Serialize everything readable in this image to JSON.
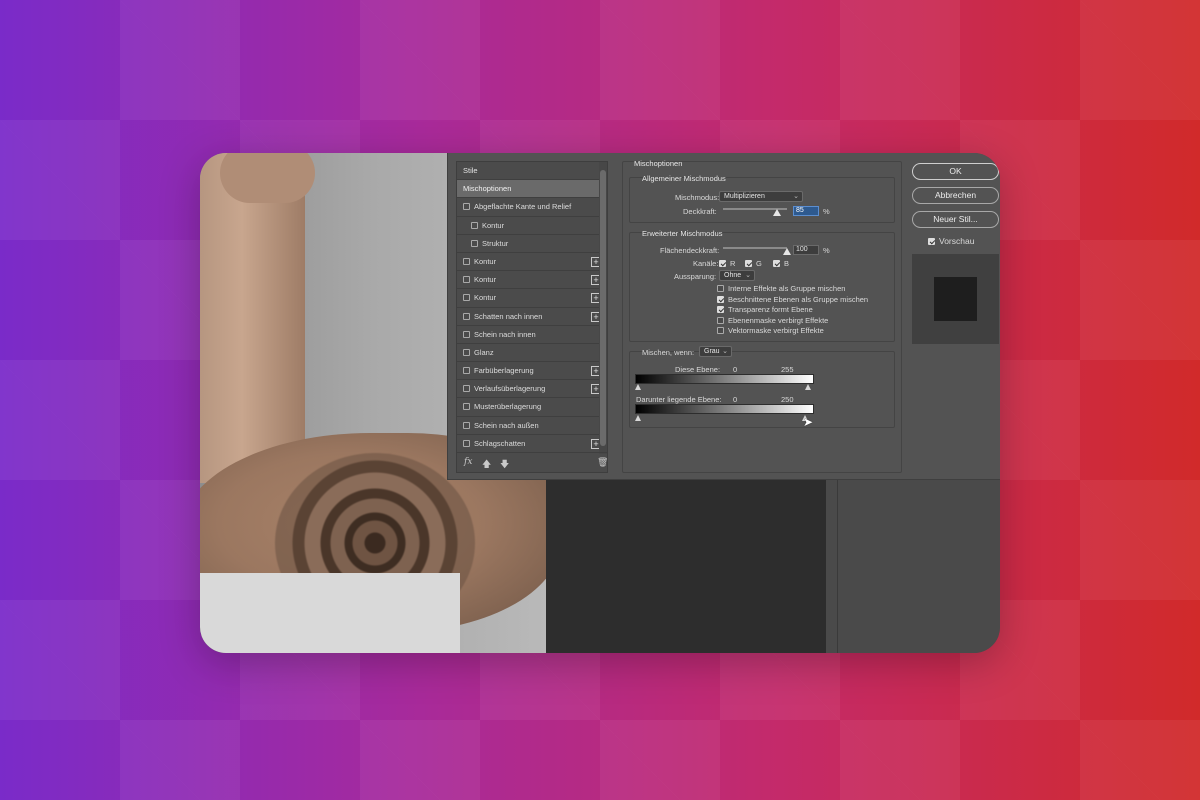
{
  "styles_panel": {
    "header": "Stile",
    "items": [
      {
        "label": "Mischoptionen",
        "checkbox": false,
        "plus": false,
        "selected": true,
        "indent": false,
        "checked": false
      },
      {
        "label": "Abgeflachte Kante und Relief",
        "checkbox": true,
        "plus": false,
        "selected": false,
        "indent": false,
        "checked": false
      },
      {
        "label": "Kontur",
        "checkbox": true,
        "plus": false,
        "selected": false,
        "indent": true,
        "checked": false
      },
      {
        "label": "Struktur",
        "checkbox": true,
        "plus": false,
        "selected": false,
        "indent": true,
        "checked": false
      },
      {
        "label": "Kontur",
        "checkbox": true,
        "plus": true,
        "selected": false,
        "indent": false,
        "checked": false
      },
      {
        "label": "Kontur",
        "checkbox": true,
        "plus": true,
        "selected": false,
        "indent": false,
        "checked": false
      },
      {
        "label": "Kontur",
        "checkbox": true,
        "plus": true,
        "selected": false,
        "indent": false,
        "checked": false
      },
      {
        "label": "Schatten nach innen",
        "checkbox": true,
        "plus": true,
        "selected": false,
        "indent": false,
        "checked": false
      },
      {
        "label": "Schein nach innen",
        "checkbox": true,
        "plus": false,
        "selected": false,
        "indent": false,
        "checked": false
      },
      {
        "label": "Glanz",
        "checkbox": true,
        "plus": false,
        "selected": false,
        "indent": false,
        "checked": false
      },
      {
        "label": "Farbüberlagerung",
        "checkbox": true,
        "plus": true,
        "selected": false,
        "indent": false,
        "checked": false
      },
      {
        "label": "Verlaufsüberlagerung",
        "checkbox": true,
        "plus": true,
        "selected": false,
        "indent": false,
        "checked": false
      },
      {
        "label": "Musterüberlagerung",
        "checkbox": true,
        "plus": false,
        "selected": false,
        "indent": false,
        "checked": false
      },
      {
        "label": "Schein nach außen",
        "checkbox": true,
        "plus": false,
        "selected": false,
        "indent": false,
        "checked": false
      },
      {
        "label": "Schlagschatten",
        "checkbox": true,
        "plus": true,
        "selected": false,
        "indent": false,
        "checked": false
      }
    ],
    "footer_fx": "fx"
  },
  "blend_options": {
    "section_title": "Mischoptionen",
    "general": {
      "title": "Allgemeiner Mischmodus",
      "mode_label": "Mischmodus:",
      "mode_value": "Multiplizieren",
      "opacity_label": "Deckkraft:",
      "opacity_value": "85",
      "opacity_unit": "%",
      "opacity_level": 0.85
    },
    "advanced": {
      "title": "Erweiterter Mischmodus",
      "fill_label": "Flächendeckkraft:",
      "fill_value": "100",
      "fill_unit": "%",
      "fill_level": 1.0,
      "channels_label": "Kanäle:",
      "channels": [
        {
          "label": "R",
          "checked": true
        },
        {
          "label": "G",
          "checked": true
        },
        {
          "label": "B",
          "checked": true
        }
      ],
      "knockout_label": "Aussparung:",
      "knockout_value": "Ohne",
      "options": [
        {
          "label": "Interne Effekte als Gruppe mischen",
          "checked": false
        },
        {
          "label": "Beschnittene Ebenen als Gruppe mischen",
          "checked": true
        },
        {
          "label": "Transparenz formt Ebene",
          "checked": true
        },
        {
          "label": "Ebenenmaske verbirgt Effekte",
          "checked": false
        },
        {
          "label": "Vektormaske verbirgt Effekte",
          "checked": false
        }
      ]
    },
    "blend_if": {
      "label": "Mischen, wenn:",
      "value": "Grau",
      "this_layer_label": "Diese Ebene:",
      "this_layer_min": "0",
      "this_layer_max": "255",
      "underlying_label": "Darunter liegende Ebene:",
      "underlying_min": "0",
      "underlying_max": "250"
    }
  },
  "buttons": {
    "ok": "OK",
    "cancel": "Abbrechen",
    "new_style": "Neuer Stil...",
    "preview_label": "Vorschau",
    "preview_checked": true
  }
}
